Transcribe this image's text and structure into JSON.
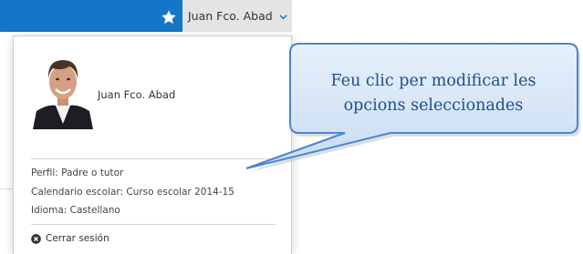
{
  "header": {
    "user_name": "Juan Fco. Abad",
    "favorite_icon": "star-icon",
    "dropdown_icon": "chevron-down-icon",
    "colors": {
      "bar": "#1576c8",
      "user_area": "#e4e4e4"
    }
  },
  "user_menu": {
    "avatar_icon": "user-photo",
    "user_name": "Juan Fco. Abad",
    "profile": "Perfil: Padre o tutor",
    "school_calendar": "Calendario escolar: Curso escolar 2014-15",
    "language": "Idioma: Castellano",
    "logout_label": "Cerrar sesión",
    "logout_icon": "close-circle-icon"
  },
  "callout": {
    "text_line1": "Feu clic per modificar les",
    "text_line2": "opcions seleccionades",
    "colors": {
      "fill": "#d6e6f8",
      "border": "#4a86d0",
      "text": "#1f4f8c"
    }
  }
}
